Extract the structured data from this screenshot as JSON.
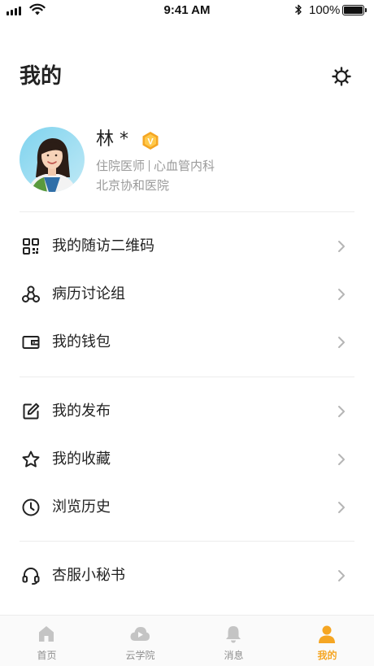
{
  "status_bar": {
    "time": "9:41 AM",
    "battery": "100%",
    "icons": [
      "signal-icon",
      "wifi-icon",
      "bluetooth-icon",
      "battery-icon"
    ]
  },
  "header": {
    "title": "我的",
    "settings_icon": "gear-icon"
  },
  "profile": {
    "name": "林 *",
    "badge_letter": "V",
    "title": "住院医师",
    "department": "心血管内科",
    "hospital": "北京协和医院"
  },
  "menu_groups": [
    [
      {
        "label": "我的随访二维码",
        "icon": "qr-code-icon"
      },
      {
        "label": "病历讨论组",
        "icon": "group-network-icon"
      },
      {
        "label": "我的钱包",
        "icon": "wallet-icon"
      }
    ],
    [
      {
        "label": "我的发布",
        "icon": "edit-icon"
      },
      {
        "label": "我的收藏",
        "icon": "star-icon"
      },
      {
        "label": "浏览历史",
        "icon": "clock-icon"
      }
    ],
    [
      {
        "label": "杏服小秘书",
        "icon": "headset-icon"
      }
    ]
  ],
  "tabs": [
    {
      "label": "首页",
      "icon": "home-icon",
      "active": false
    },
    {
      "label": "云学院",
      "icon": "cloud-play-icon",
      "active": false
    },
    {
      "label": "消息",
      "icon": "bell-icon",
      "active": false
    },
    {
      "label": "我的",
      "icon": "person-icon",
      "active": true
    }
  ],
  "colors": {
    "accent": "#f5a623",
    "inactive": "#c4c4c4",
    "secondary_text": "#9a9a9a"
  }
}
